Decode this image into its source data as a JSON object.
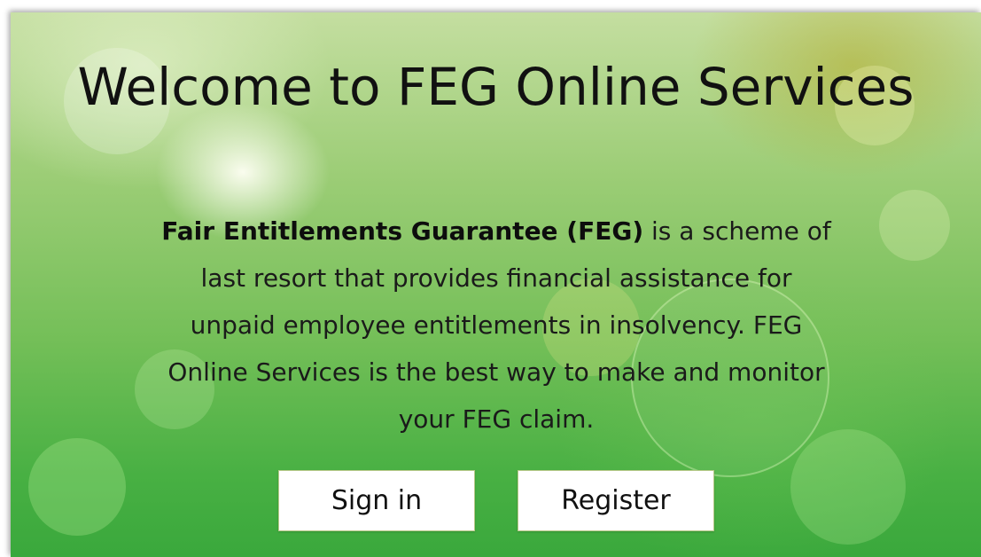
{
  "page": {
    "title": "Welcome to FEG Online Services",
    "intro_bold": "Fair Entitlements Guarantee (FEG)",
    "intro_text": " is a scheme of last resort that provides financial assistance for unpaid employee entitlements in insolvency. FEG Online Services is the best way to make and monitor your FEG claim."
  },
  "actions": {
    "sign_in_label": "Sign in",
    "register_label": "Register"
  },
  "colors": {
    "background_top": "#c4dea0",
    "background_bottom": "#3aa83c",
    "button_bg": "#ffffff",
    "text": "#111111"
  }
}
